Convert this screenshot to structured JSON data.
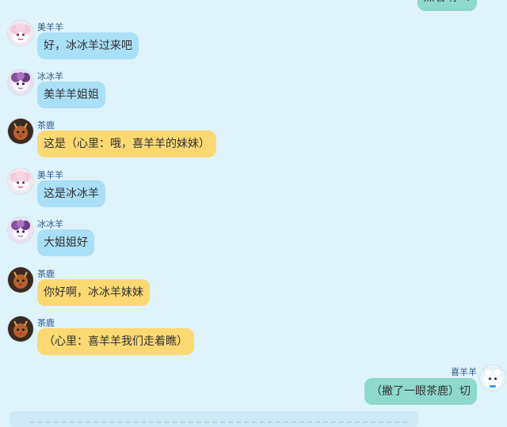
{
  "chat": {
    "top_cut_text": "点着呐~!",
    "messages": [
      {
        "sender": "美羊羊",
        "text": "好，冰冰羊过来吧"
      },
      {
        "sender": "冰冰羊",
        "text": "美羊羊姐姐"
      },
      {
        "sender": "茶鹿",
        "text": "这是（心里：哦，喜羊羊的妹妹）"
      },
      {
        "sender": "美羊羊",
        "text": "这是冰冰羊"
      },
      {
        "sender": "冰冰羊",
        "text": "大姐姐好"
      },
      {
        "sender": "茶鹿",
        "text": "你好啊，冰冰羊妹妹"
      },
      {
        "sender": "茶鹿",
        "text": "（心里：喜羊羊我们走着瞧）"
      },
      {
        "sender": "喜羊羊",
        "text": "（撇了一眼茶鹿）切"
      }
    ]
  },
  "colors": {
    "background": "#dff3fb",
    "bubble_blue": "#a9dff7",
    "bubble_yellow": "#fbd872",
    "bubble_teal": "#8fd9cc",
    "name_text": "#2a5a8a"
  },
  "icons": {
    "meiyangyang": "pink-sheep-avatar-icon",
    "bingbingyang": "purple-sheep-avatar-icon",
    "chalu": "deer-avatar-icon",
    "xiyangyang": "white-sheep-avatar-icon"
  }
}
